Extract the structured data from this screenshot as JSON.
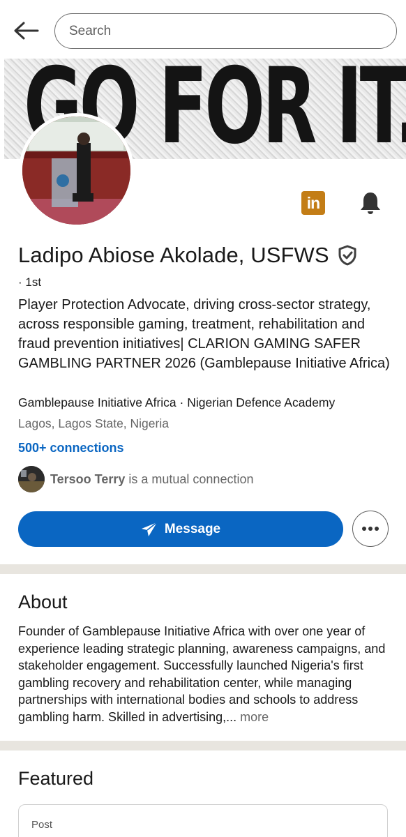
{
  "search": {
    "placeholder": "Search"
  },
  "banner": {
    "text": "GO FOR IT."
  },
  "profile": {
    "name": "Ladipo Abiose Akolade, USFWS",
    "degree": "· 1st",
    "headline": "Player Protection Advocate, driving cross-sector strategy, across responsible gaming, treatment, rehabilitation and fraud prevention initiatives| CLARION GAMING SAFER GAMBLING PARTNER 2026 (Gamblepause Initiative Africa)",
    "organizations": "Gamblepause Initiative Africa · Nigerian Defence Academy",
    "location": "Lagos, Lagos State, Nigeria",
    "connections": "500+ connections",
    "mutual_name": "Tersoo Terry",
    "mutual_suffix": " is a mutual connection",
    "message_label": "Message"
  },
  "about": {
    "title": "About",
    "text": "Founder of Gamblepause Initiative Africa with over one year of experience leading strategic planning, awareness campaigns, and stakeholder engagement. Successfully launched Nigeria's first gambling recovery and rehabilitation center, while managing partnerships with international bodies and schools to address gambling harm. Skilled in advertising,...",
    "more_label": " more"
  },
  "featured": {
    "title": "Featured",
    "post_label": "Post"
  },
  "colors": {
    "primary": "#0a66c2",
    "linkedin_badge": "#c37d16",
    "divider": "#e8e5df"
  },
  "icons": {
    "back": "arrow-left-icon",
    "linkedin": "linkedin-icon",
    "bell": "bell-icon",
    "verified": "verified-shield-icon",
    "send": "send-icon",
    "more": "more-horizontal-icon"
  }
}
